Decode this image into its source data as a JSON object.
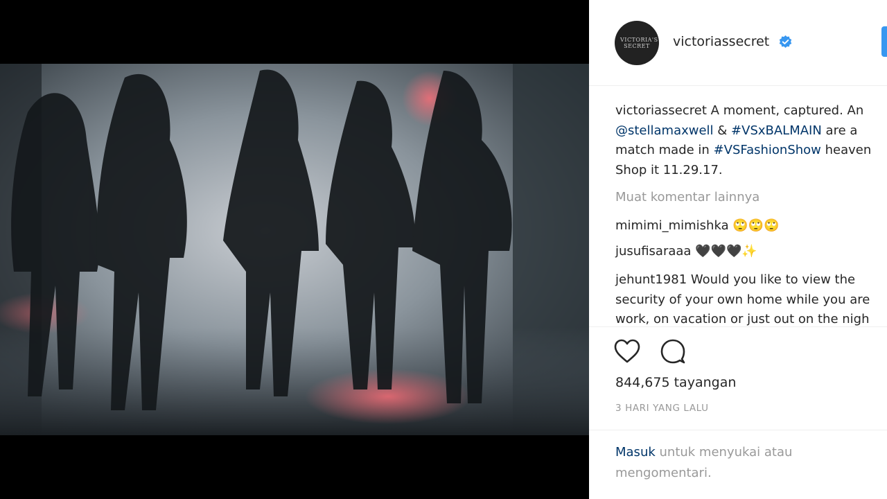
{
  "post": {
    "avatar_text": "VICTORIA'S SECRET",
    "username": "victoriassecret",
    "caption": {
      "user": "victoriassecret",
      "lines": [
        [
          {
            "text": "A moment, captured. An",
            "link": false
          }
        ],
        [
          {
            "text": "@stellamaxwell",
            "link": true
          },
          {
            "text": " & ",
            "link": false
          },
          {
            "text": "#VSxBALMAIN",
            "link": true
          },
          {
            "text": " are a",
            "link": false
          }
        ],
        [
          {
            "text": "match made in ",
            "link": false
          },
          {
            "text": "#VSFashionShow",
            "link": true
          },
          {
            "text": " heaven",
            "link": false
          }
        ],
        [
          {
            "text": "Shop it 11.29.17.",
            "link": false
          }
        ]
      ]
    },
    "load_more": "Muat komentar lainnya",
    "comments": [
      {
        "user": "mimimi_mimishka",
        "lines": [
          "🙄🙄🙄"
        ]
      },
      {
        "user": "jusufisaraaa",
        "lines": [
          "🖤🖤🖤✨"
        ]
      },
      {
        "user": "jehunt1981",
        "lines": [
          "Would you like to view the",
          "security of your own home while you are",
          "work, on vacation or just out on the nigh"
        ]
      }
    ],
    "views": "844,675 tayangan",
    "time_ago": "3 HARI YANG LALU",
    "login_prompt": {
      "link": "Masuk",
      "rest": " untuk menyukai atau mengomentari."
    }
  },
  "icons": {
    "like": "heart-icon",
    "comment": "comment-bubble-icon",
    "verified": "verified-badge-icon"
  },
  "colors": {
    "link": "#003569",
    "muted": "#999999",
    "verified": "#3897f0"
  }
}
